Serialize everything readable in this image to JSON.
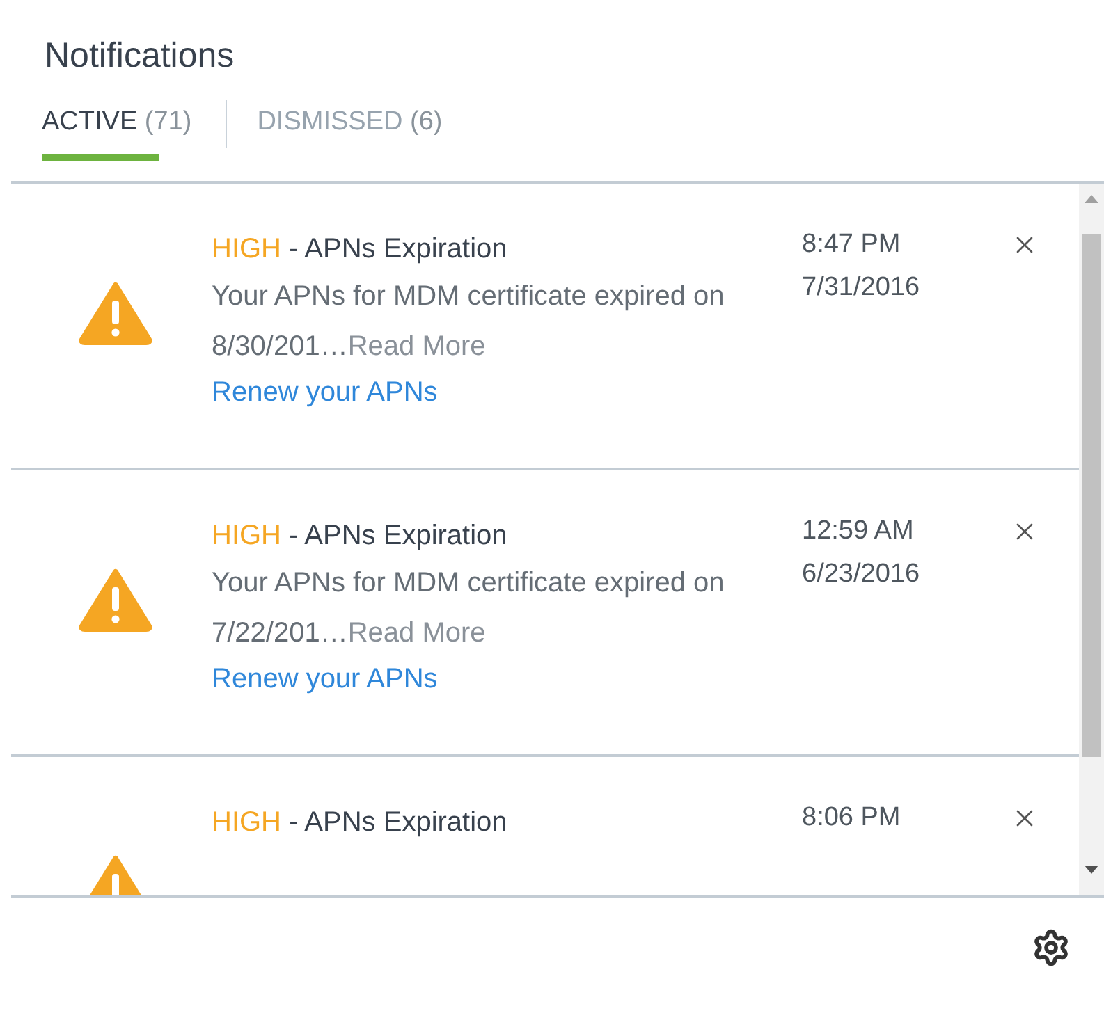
{
  "title": "Notifications",
  "tabs": [
    {
      "label": "ACTIVE",
      "count": "(71)",
      "selected": true
    },
    {
      "label": "DISMISSED",
      "count": "(6)",
      "selected": false
    }
  ],
  "notifications": [
    {
      "severity": "HIGH",
      "title": "- APNs Expiration",
      "body": "Your APNs for MDM certificate expired on 8/30/201…",
      "more": "Read More",
      "action": "Renew your APNs",
      "time": "8:47 PM",
      "date": "7/31/2016"
    },
    {
      "severity": "HIGH",
      "title": "- APNs Expiration",
      "body": "Your APNs for MDM certificate expired on 7/22/201…",
      "more": "Read More",
      "action": "Renew your APNs",
      "time": "12:59 AM",
      "date": "6/23/2016"
    },
    {
      "severity": "HIGH",
      "title": "- APNs Expiration",
      "time": "8:06 PM"
    }
  ]
}
